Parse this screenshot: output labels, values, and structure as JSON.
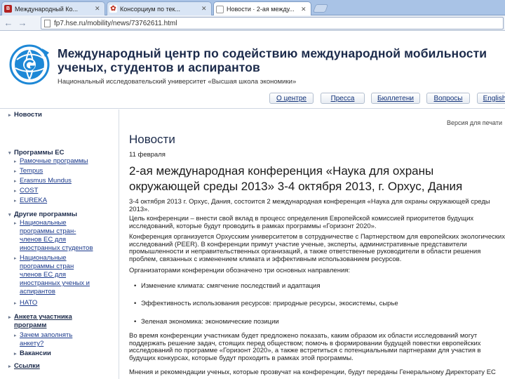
{
  "browser": {
    "tabs": [
      {
        "label": "Международный Ко...",
        "favicon_letter": "В",
        "favicon_color": "#b22222",
        "active": false
      },
      {
        "label": "Консорциум по тек...",
        "favicon_letter": "✿",
        "favicon_color": "#c0392b",
        "active": false
      },
      {
        "label": "Новости · 2-ая между...",
        "favicon_letter": "",
        "favicon_color": "#ffffff",
        "active": true
      }
    ],
    "url": "fp7.hse.ru/mobility/news/73762611.html"
  },
  "header": {
    "title": "Международный центр по содействию международной мобильности ученых, студентов и аспирантов",
    "subtitle": "Национальный исследовательский университет «Высшая школа экономики»",
    "nav": [
      "О центре",
      "Пресса",
      "Бюллетени",
      "Вопросы",
      "English"
    ]
  },
  "sidebar": {
    "rows": [
      {
        "text": "Новости",
        "kind": "head",
        "marker": "▸"
      },
      {
        "text": "Программы ЕС",
        "kind": "head",
        "marker": "▾"
      },
      {
        "text": "Рамочные программы",
        "kind": "link",
        "marker": "▸"
      },
      {
        "text": "Tempus",
        "kind": "link",
        "marker": "▸"
      },
      {
        "text": "Erasmus Mundus",
        "kind": "link",
        "marker": "▸"
      },
      {
        "text": "COST",
        "kind": "link",
        "marker": "▸"
      },
      {
        "text": "EUREKA",
        "kind": "link",
        "marker": "▸"
      },
      {
        "text": "Другие программы",
        "kind": "head",
        "marker": "▾"
      },
      {
        "text": "Национальные",
        "kind": "link",
        "marker": "▸"
      },
      {
        "text": "программы стран-",
        "kind": "link",
        "marker": ""
      },
      {
        "text": "членов ЕС для",
        "kind": "link",
        "marker": ""
      },
      {
        "text": "иностранных студентов",
        "kind": "link",
        "marker": ""
      },
      {
        "text": "Национальные",
        "kind": "link",
        "marker": "▸"
      },
      {
        "text": "программы стран",
        "kind": "link",
        "marker": ""
      },
      {
        "text": "членов ЕС для",
        "kind": "link",
        "marker": ""
      },
      {
        "text": "иностранных ученых и",
        "kind": "link",
        "marker": ""
      },
      {
        "text": "аспирантов",
        "kind": "link",
        "marker": ""
      },
      {
        "text": "НАТО",
        "kind": "link",
        "marker": "▸"
      },
      {
        "text": "Анкета участника",
        "kind": "head",
        "marker": "▸"
      },
      {
        "text": "программ",
        "kind": "head",
        "marker": ""
      },
      {
        "text": "Зачем заполнять",
        "kind": "link",
        "marker": "▸"
      },
      {
        "text": "анкету?",
        "kind": "link",
        "marker": ""
      },
      {
        "text": "Вакансии",
        "kind": "head",
        "marker": "▸"
      },
      {
        "text": "Ссылки",
        "kind": "head",
        "marker": "▸"
      }
    ]
  },
  "main": {
    "version_link": "Версия для печати",
    "title": "Новости",
    "date": "11 февраля",
    "headline": "2-ая международная конференция «Наука для охраны окружающей среды 2013» 3-4 октября 2013, г. Орхус, Дания",
    "p1": "3-4 октября 2013 г. Орхус, Дания, состоится 2 международная конференция «Наука для охраны окружающей среды 2013».",
    "p2": "Цель конференции – внести свой вклад в процесс определения Европейской комиссией приоритетов будущих исследований, которые будут проводить в рамках программы «Горизонт 2020».",
    "p3": "Конференция организуется Орхусским университетом в сотрудничестве с Партнерством для европейских экологических исследований (PEER). В конференции примут участие ученые, эксперты, административные представители промышленности и неправительственных организаций, а также ответственные руководители в области решения проблем, связанных с изменением климата и эффективным использованием ресурсов.",
    "p4": "Организаторами конференции обозначено три основных направления:",
    "bullets": [
      "Изменение климата: смягчение последствий и адаптация",
      "Эффективность использования ресурсов: природные ресурсы, экосистемы, сырье",
      "Зеленая экономика: экономические позиции"
    ],
    "p5": "Во время конференции участникам будет предложено показать, каким образом их области исследований могут поддержать решение задач, стоящих перед обществом; помочь в формировании будущей повестки европейских исследований по программе «Горизонт 2020», а также встретиться с потенциальными партнерами для участия в будущих конкурсах, которые будут проходить в рамках этой программы.",
    "p6": "Мнения и рекомендации ученых, которые прозвучат на конференции, будут переданы Генеральному Директорату ЕС"
  },
  "colors": {
    "tabbar": "#a9c3e6",
    "header_text": "#1b2a4a",
    "link": "#1b3a8c",
    "logo_blue": "#1e88d6"
  }
}
